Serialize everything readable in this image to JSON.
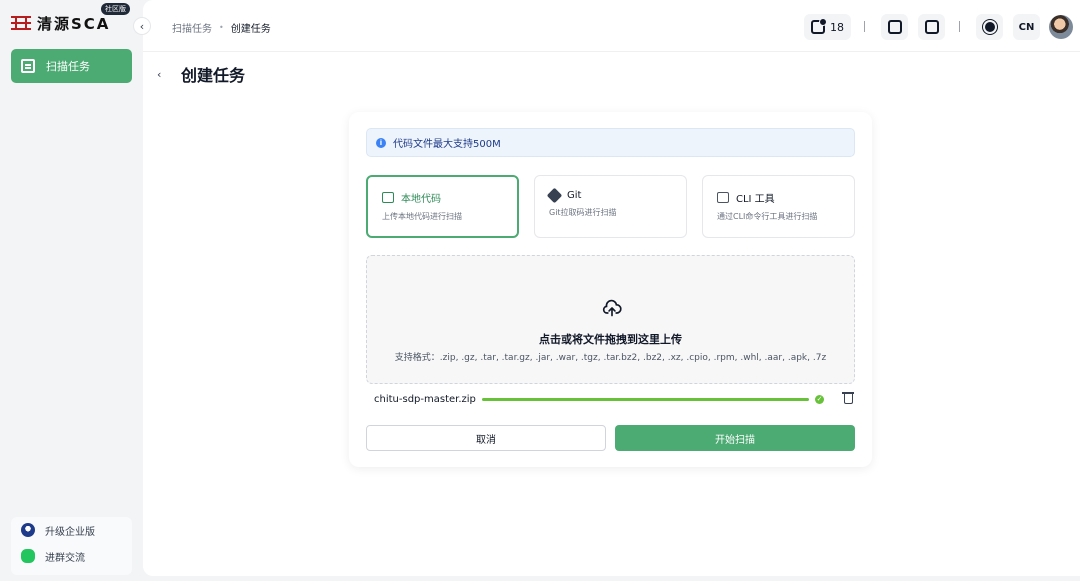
{
  "brand": {
    "name": "清源SCA",
    "edition": "社区版"
  },
  "sidebar": {
    "items": [
      {
        "label": "扫描任务"
      }
    ],
    "bottom": [
      {
        "label": "升级企业版"
      },
      {
        "label": "进群交流"
      }
    ]
  },
  "header": {
    "breadcrumb": [
      "扫描任务",
      "创建任务"
    ],
    "notifications": "18",
    "language": "CN"
  },
  "page": {
    "title": "创建任务"
  },
  "form": {
    "alert": "代码文件最大支持500M",
    "options": [
      {
        "title": "本地代码",
        "desc": "上传本地代码进行扫描"
      },
      {
        "title": "Git",
        "desc": "Git拉取码进行扫描"
      },
      {
        "title": "CLI 工具",
        "desc": "通过CLI命令行工具进行扫描"
      }
    ],
    "upload": {
      "title": "点击或将文件拖拽到这里上传",
      "formats": "支持格式：.zip, .gz, .tar, .tar.gz, .jar, .war, .tgz, .tar.bz2, .bz2, .xz, .cpio, .rpm, .whl, .aar, .apk, .7z"
    },
    "file": {
      "name": "chitu-sdp-master.zip",
      "progress": 1.0
    },
    "cancel_label": "取消",
    "start_label": "开始扫描"
  },
  "colors": {
    "accent": "#4caa73",
    "success": "#67c23a",
    "info": "#3b82f6"
  }
}
